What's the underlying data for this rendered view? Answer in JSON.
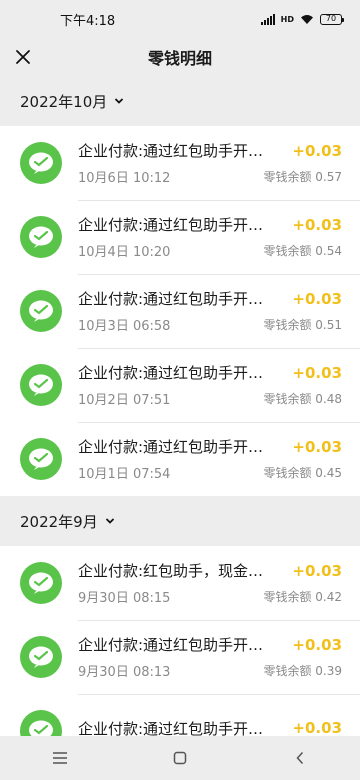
{
  "status_bar": {
    "time": "下午4:18",
    "battery": "70"
  },
  "nav": {
    "title": "零钱明细"
  },
  "groups": [
    {
      "month": "2022年10月",
      "items": [
        {
          "title": "企业付款:通过红包助手开…",
          "time": "10月6日 10:12",
          "amount": "+0.03",
          "balance": "零钱余额 0.57"
        },
        {
          "title": "企业付款:通过红包助手开…",
          "time": "10月4日 10:20",
          "amount": "+0.03",
          "balance": "零钱余额 0.54"
        },
        {
          "title": "企业付款:通过红包助手开…",
          "time": "10月3日 06:58",
          "amount": "+0.03",
          "balance": "零钱余额 0.51"
        },
        {
          "title": "企业付款:通过红包助手开…",
          "time": "10月2日 07:51",
          "amount": "+0.03",
          "balance": "零钱余额 0.48"
        },
        {
          "title": "企业付款:通过红包助手开…",
          "time": "10月1日 07:54",
          "amount": "+0.03",
          "balance": "零钱余额 0.45"
        }
      ]
    },
    {
      "month": "2022年9月",
      "items": [
        {
          "title": "企业付款:红包助手，现金…",
          "time": "9月30日 08:15",
          "amount": "+0.03",
          "balance": "零钱余额 0.42"
        },
        {
          "title": "企业付款:通过红包助手开…",
          "time": "9月30日 08:13",
          "amount": "+0.03",
          "balance": "零钱余额 0.39"
        },
        {
          "title": "企业付款:通过红包助手开…",
          "time": "",
          "amount": "+0.03",
          "balance": ""
        }
      ]
    }
  ],
  "colors": {
    "avatar_green": "#5ac44a",
    "amount_yellow": "#f2c01c",
    "background": "#ededed"
  },
  "icons": {
    "avatar": "wechat-pay-icon",
    "close": "close-icon",
    "chevron": "chevron-down-icon",
    "nav": [
      "menu-icon",
      "home-icon",
      "back-icon"
    ]
  }
}
